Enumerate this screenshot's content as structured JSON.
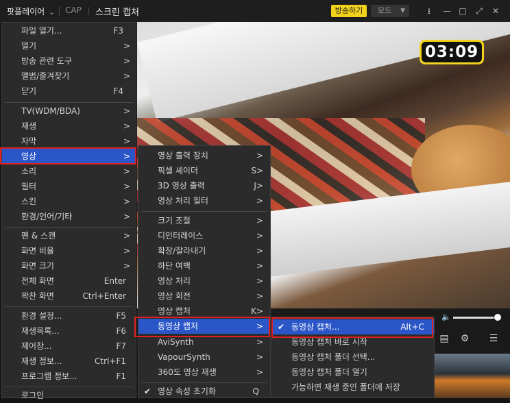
{
  "titlebar": {
    "app_menu": "팟플레이어",
    "cap": "CAP",
    "title": "스크린 캡처",
    "broadcast_button": "방송하기",
    "mode_select": "모드"
  },
  "timer": "03:09",
  "main_menu": [
    {
      "label": "파일 열기...",
      "shortcut": "F3"
    },
    {
      "label": "열기",
      "shortcut": ">"
    },
    {
      "label": "방송 관련 도구",
      "shortcut": ">"
    },
    {
      "label": "앨범/즐겨찾기",
      "shortcut": ">"
    },
    {
      "label": "닫기",
      "shortcut": "F4"
    },
    {
      "label": "TV(WDM/BDA)",
      "shortcut": ">"
    },
    {
      "label": "재생",
      "shortcut": ">"
    },
    {
      "label": "자막",
      "shortcut": ">"
    },
    {
      "label": "영상",
      "shortcut": ">"
    },
    {
      "label": "소리",
      "shortcut": ">"
    },
    {
      "label": "필터",
      "shortcut": ">"
    },
    {
      "label": "스킨",
      "shortcut": ">"
    },
    {
      "label": "환경/언어/기타",
      "shortcut": ">"
    },
    {
      "label": "팬 & 스캔",
      "shortcut": ">"
    },
    {
      "label": "화면 비율",
      "shortcut": ">"
    },
    {
      "label": "화면 크기",
      "shortcut": ">"
    },
    {
      "label": "전체 화면",
      "shortcut": "Enter"
    },
    {
      "label": "꽉찬 화면",
      "shortcut": "Ctrl+Enter"
    },
    {
      "label": "환경 설정...",
      "shortcut": "F5"
    },
    {
      "label": "재생목록...",
      "shortcut": "F6"
    },
    {
      "label": "제어창...",
      "shortcut": "F7"
    },
    {
      "label": "재생 정보...",
      "shortcut": "Ctrl+F1"
    },
    {
      "label": "프로그램 정보...",
      "shortcut": "F1"
    },
    {
      "label": "로그인",
      "shortcut": ""
    }
  ],
  "video_menu": [
    {
      "label": "영상 출력 장치",
      "shortcut": ">"
    },
    {
      "label": "픽셀 셰이더",
      "shortcut": "S>"
    },
    {
      "label": "3D 영상 출력",
      "shortcut": "J>"
    },
    {
      "label": "영상 처리 필터",
      "shortcut": ">"
    },
    {
      "label": "크기 조절",
      "shortcut": ">"
    },
    {
      "label": "디인터레이스",
      "shortcut": ">"
    },
    {
      "label": "확장/잘라내기",
      "shortcut": ">"
    },
    {
      "label": "하단 여백",
      "shortcut": ">"
    },
    {
      "label": "영상 처리",
      "shortcut": ">"
    },
    {
      "label": "영상 회전",
      "shortcut": ">"
    },
    {
      "label": "영상 캡처",
      "shortcut": "K>"
    },
    {
      "label": "동영상 캡처",
      "shortcut": ">"
    },
    {
      "label": "AviSynth",
      "shortcut": ">"
    },
    {
      "label": "VapourSynth",
      "shortcut": ">"
    },
    {
      "label": "360도 영상 재생",
      "shortcut": ">"
    },
    {
      "label": "영상 속성 초기화",
      "shortcut": "Q"
    }
  ],
  "capture_menu": [
    {
      "label": "동영상 캡처...",
      "shortcut": "Alt+C"
    },
    {
      "label": "동영상 캡처 바로 시작",
      "shortcut": ""
    },
    {
      "label": "동영상 캡처 폴더 선택...",
      "shortcut": ""
    },
    {
      "label": "동영상 캡처 폴더 열기",
      "shortcut": ""
    },
    {
      "label": "가능하면 재생 중인 폴더에 저장",
      "shortcut": ""
    }
  ],
  "volume_level": 0.9,
  "colors": {
    "highlight": "#2a56c8",
    "outline": "#e0211f",
    "accent": "#f2d21a"
  }
}
